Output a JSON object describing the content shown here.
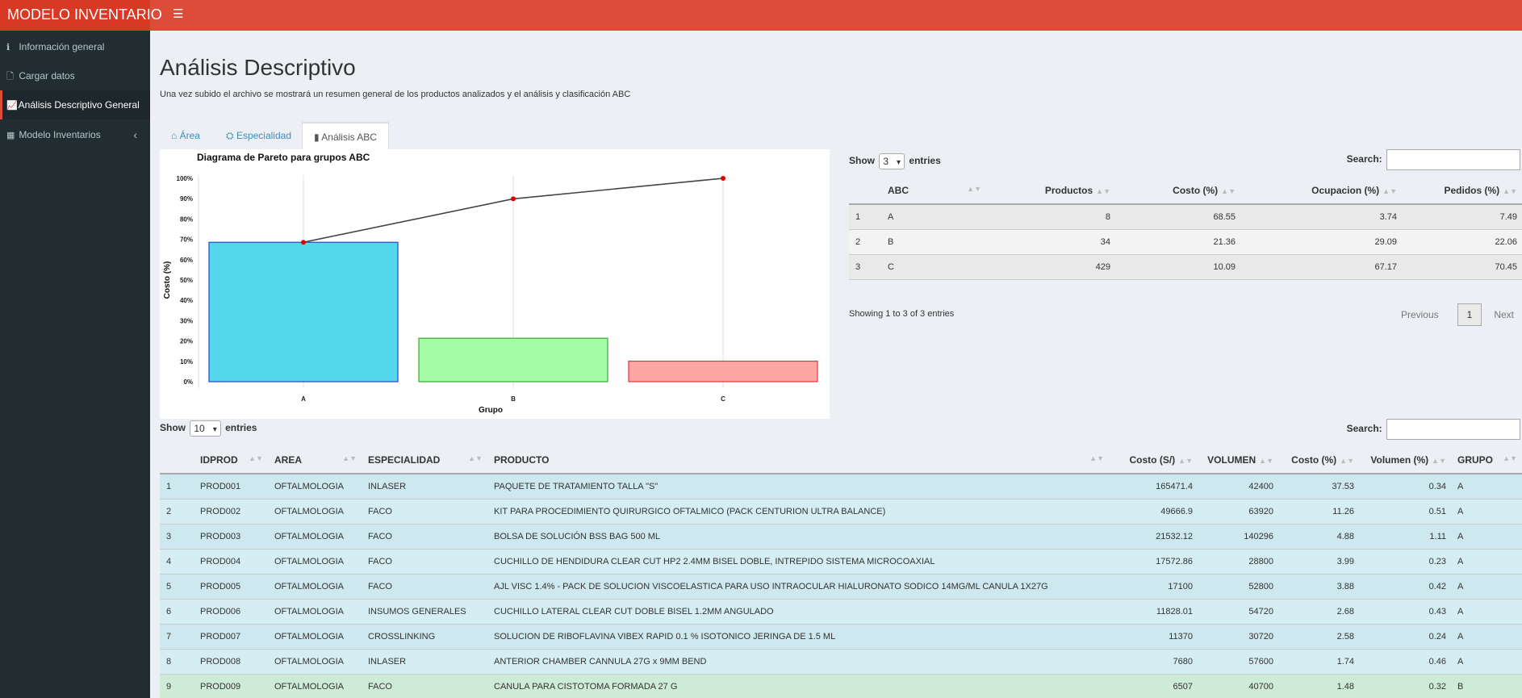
{
  "app": {
    "title": "MODELO INVENTARIO",
    "menu_icon": "bars-icon"
  },
  "sidebar": {
    "items": [
      {
        "label": "Información general",
        "icon": "info-icon"
      },
      {
        "label": "Cargar datos",
        "icon": "file-icon"
      },
      {
        "label": "Análisis Descriptivo General",
        "icon": "chart-line-icon"
      },
      {
        "label": "Modelo Inventarios",
        "icon": "cubes-icon"
      }
    ]
  },
  "page": {
    "title": "Análisis Descriptivo",
    "description": "Una vez subido el archivo se mostrará un resumen general de los productos analizados y el análisis y clasificación ABC"
  },
  "tabs": [
    {
      "label": "Área",
      "icon": "home-icon"
    },
    {
      "label": "Especialidad",
      "icon": "cubes-icon"
    },
    {
      "label": "Análisis ABC",
      "icon": "bar-chart-icon"
    }
  ],
  "chart_data": {
    "type": "bar",
    "title": "Diagrama de Pareto para grupos ABC",
    "xlabel": "Grupo",
    "ylabel": "Costo (%)",
    "categories": [
      "A",
      "B",
      "C"
    ],
    "values": [
      68.55,
      21.36,
      10.09
    ],
    "cumulative": [
      68.55,
      89.91,
      100
    ],
    "ylim": [
      0,
      100
    ],
    "yticks": [
      "0%",
      "10%",
      "20%",
      "30%",
      "40%",
      "50%",
      "60%",
      "70%",
      "80%",
      "90%",
      "100%"
    ],
    "colors": {
      "A": "#52d8ea",
      "B": "#a6fca6",
      "C": "#fca6a6",
      "line": "#444444",
      "points": "#e00000"
    }
  },
  "abc_table": {
    "show_label": "Show",
    "show_value": "3",
    "entries_label": "entries",
    "search_label": "Search:",
    "columns": [
      "",
      "ABC",
      "Productos",
      "Costo (%)",
      "Ocupacion (%)",
      "Pedidos (%)"
    ],
    "rows": [
      [
        "1",
        "A",
        "8",
        "68.55",
        "3.74",
        "7.49"
      ],
      [
        "2",
        "B",
        "34",
        "21.36",
        "29.09",
        "22.06"
      ],
      [
        "3",
        "C",
        "429",
        "10.09",
        "67.17",
        "70.45"
      ]
    ],
    "info": "Showing 1 to 3 of 3 entries",
    "pager": {
      "previous": "Previous",
      "current": "1",
      "next": "Next"
    }
  },
  "products_table": {
    "show_label": "Show",
    "show_value": "10",
    "entries_label": "entries",
    "search_label": "Search:",
    "columns": [
      "",
      "IDPROD",
      "AREA",
      "ESPECIALIDAD",
      "PRODUCTO",
      "Costo (S/)",
      "VOLUMEN",
      "Costo (%)",
      "Volumen (%)",
      "GRUPO"
    ],
    "rows": [
      [
        "1",
        "PROD001",
        "OFTALMOLOGIA",
        "INLASER",
        "PAQUETE DE TRATAMIENTO TALLA \"S\"",
        "165471.4",
        "42400",
        "37.53",
        "0.34",
        "A"
      ],
      [
        "2",
        "PROD002",
        "OFTALMOLOGIA",
        "FACO",
        "KIT PARA PROCEDIMIENTO QUIRURGICO OFTALMICO (PACK CENTURION ULTRA BALANCE)",
        "49666.9",
        "63920",
        "11.26",
        "0.51",
        "A"
      ],
      [
        "3",
        "PROD003",
        "OFTALMOLOGIA",
        "FACO",
        "BOLSA DE SOLUCIÓN BSS BAG 500 ML",
        "21532.12",
        "140296",
        "4.88",
        "1.11",
        "A"
      ],
      [
        "4",
        "PROD004",
        "OFTALMOLOGIA",
        "FACO",
        "CUCHILLO DE HENDIDURA CLEAR CUT HP2 2.4MM BISEL DOBLE, INTREPIDO SISTEMA MICROCOAXIAL",
        "17572.86",
        "28800",
        "3.99",
        "0.23",
        "A"
      ],
      [
        "5",
        "PROD005",
        "OFTALMOLOGIA",
        "FACO",
        "AJL VISC 1.4% - PACK DE SOLUCION VISCOELASTICA PARA USO INTRAOCULAR HIALURONATO SODICO 14MG/ML CANULA 1X27G",
        "17100",
        "52800",
        "3.88",
        "0.42",
        "A"
      ],
      [
        "6",
        "PROD006",
        "OFTALMOLOGIA",
        "INSUMOS GENERALES",
        "CUCHILLO LATERAL CLEAR CUT DOBLE BISEL 1.2MM ANGULADO",
        "11828.01",
        "54720",
        "2.68",
        "0.43",
        "A"
      ],
      [
        "7",
        "PROD007",
        "OFTALMOLOGIA",
        "CROSSLINKING",
        "SOLUCION DE RIBOFLAVINA VIBEX RAPID 0.1 % ISOTONICO JERINGA DE 1.5 ML",
        "11370",
        "30720",
        "2.58",
        "0.24",
        "A"
      ],
      [
        "8",
        "PROD008",
        "OFTALMOLOGIA",
        "INLASER",
        "ANTERIOR CHAMBER CANNULA 27G x 9MM BEND",
        "7680",
        "57600",
        "1.74",
        "0.46",
        "A"
      ],
      [
        "9",
        "PROD009",
        "OFTALMOLOGIA",
        "FACO",
        "CANULA PARA CISTOTOMA FORMADA 27 G",
        "6507",
        "40700",
        "1.48",
        "0.32",
        "B"
      ]
    ]
  }
}
